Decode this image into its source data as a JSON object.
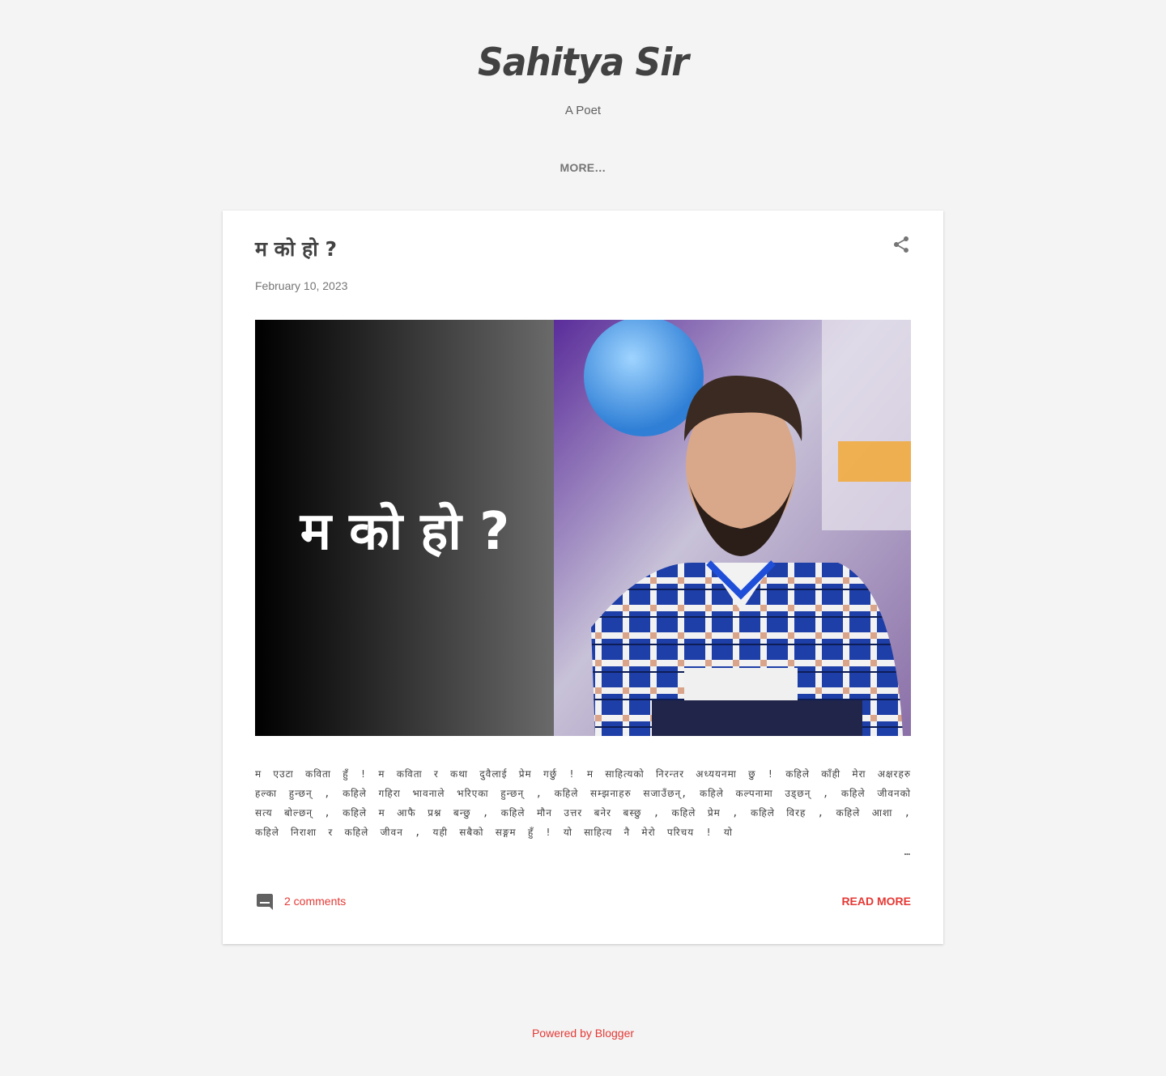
{
  "header": {
    "title": "Sahitya Sir",
    "subtitle": "A Poet",
    "more_label": "MORE…"
  },
  "post": {
    "title": "म को हो ?",
    "date": "February 10, 2023",
    "image_text": "म को हो ?",
    "snippet": "म एउटा कविता हुँ ! म कविता र कथा दुवैलाई प्रेम गर्छु ! म साहित्यको निरन्तर अध्ययनमा छु ! कहिले काँही मेरा अक्षरहरु हल्का हुन्छन् , कहिले गहिरा भावनाले भरिएका हुन्छन् , कहिले सम्झनाहरु सजाउँछन्, कहिले कल्पनामा उड्छन् , कहिले जीवनको सत्य बोल्छन् , कहिले म आफै प्रश्न बन्छु , कहिले मौन उत्तर बनेर बस्छु , कहिले प्रेम , कहिले विरह , कहिले आशा , कहिले निराशा र कहिले जीवन , यही सबैको सङ्गम हुँ ! यो साहित्य नै मेरो परिचय ! यो",
    "ellipsis": "…",
    "comments_label": "2 comments",
    "read_more_label": "READ MORE"
  },
  "footer": {
    "powered_by": "Powered by Blogger"
  },
  "icons": {
    "share": "share-icon",
    "comment": "comment-icon"
  },
  "colors": {
    "background": "#f4f4f4",
    "card": "#ffffff",
    "accent": "#e53935",
    "title": "#424242"
  }
}
